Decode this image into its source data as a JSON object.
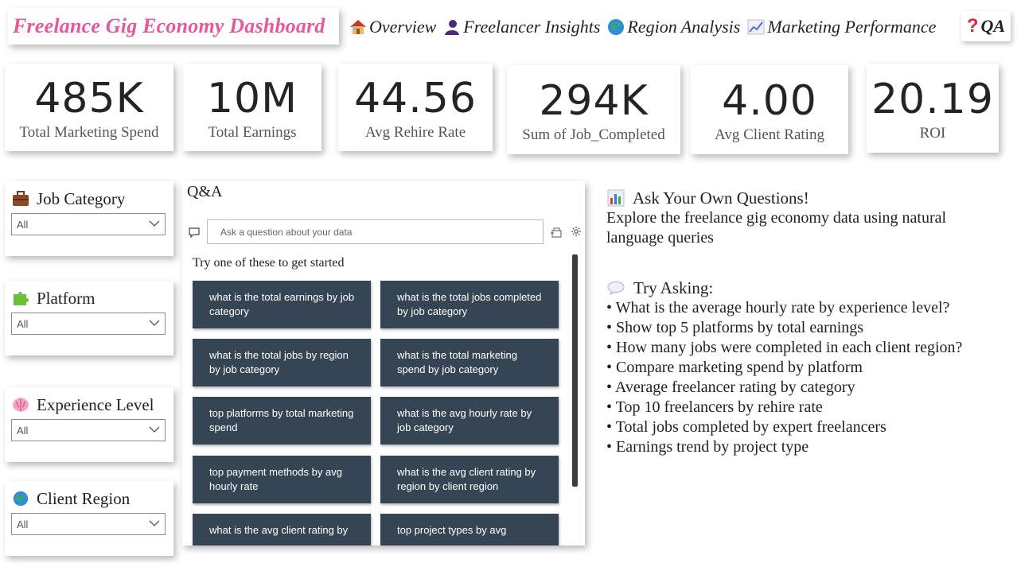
{
  "header": {
    "title": "Freelance Gig Economy Dashboard"
  },
  "nav": {
    "items": [
      {
        "icon": "house-icon",
        "label": "Overview"
      },
      {
        "icon": "person-icon",
        "label": "Freelancer Insights"
      },
      {
        "icon": "globe-icon",
        "label": "Region Analysis"
      },
      {
        "icon": "chart-up-icon",
        "label": "Marketing Performance"
      }
    ],
    "qa": {
      "icon": "question-icon",
      "symbol": "?",
      "label": "QA"
    }
  },
  "kpis": [
    {
      "value": "485K",
      "label": "Total Marketing Spend"
    },
    {
      "value": "10M",
      "label": "Total Earnings"
    },
    {
      "value": "44.56",
      "label": "Avg Rehire Rate"
    },
    {
      "value": "294K",
      "label": "Sum of Job_Completed"
    },
    {
      "value": "4.00",
      "label": "Avg Client Rating"
    },
    {
      "value": "20.19",
      "label": "ROI"
    }
  ],
  "slicers": [
    {
      "icon": "briefcase-icon",
      "title": "Job Category",
      "value": "All"
    },
    {
      "icon": "puzzle-icon",
      "title": "Platform",
      "value": "All"
    },
    {
      "icon": "brain-icon",
      "title": "Experience Level",
      "value": "All"
    },
    {
      "icon": "globe-icon",
      "title": "Client Region",
      "value": "All"
    }
  ],
  "qa_panel": {
    "title": "Q&A",
    "placeholder": "Ask a question about your data",
    "started": "Try one of these to get started",
    "suggestions": [
      "what is the total earnings by job category",
      "what is the total jobs completed by job category",
      "what is the total jobs by region by job category",
      "what is the total marketing spend by job category",
      "top platforms by total marketing spend",
      "what is the avg hourly rate by job category",
      "top payment methods by avg hourly rate",
      "what is the avg client rating by region by client region",
      "what is the avg client rating by",
      "top project types by avg"
    ]
  },
  "info": {
    "heading": "Ask Your Own Questions!",
    "desc": "Explore the freelance gig economy data using natural language queries",
    "try_heading": "Try Asking:",
    "try_items": [
      "• What is the average hourly rate by experience level?",
      "• Show top 5 platforms by total earnings",
      "• How many jobs were completed in each client region?",
      "• Compare marketing spend by platform",
      "• Average freelancer rating by category",
      "• Top 10 freelancers by rehire rate",
      "• Total jobs completed by expert freelancers",
      "• Earnings trend by project type"
    ]
  },
  "colors": {
    "title": "#e9579b",
    "button": "#354553",
    "qa_mark": "#e0243b"
  }
}
